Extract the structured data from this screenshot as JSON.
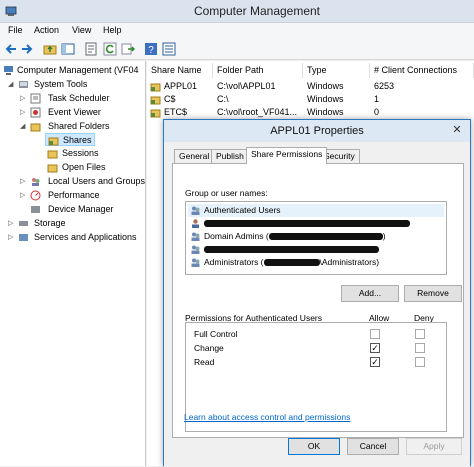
{
  "window": {
    "title": "Computer Management"
  },
  "menu": [
    "File",
    "Action",
    "View",
    "Help"
  ],
  "toolbar_icons": [
    "back-arrow-icon",
    "forward-arrow-icon",
    "up-folder-icon",
    "show-hide-tree-icon",
    "properties-icon",
    "refresh-icon",
    "export-list-icon",
    "help-icon",
    "view-icon"
  ],
  "tree": [
    {
      "label": "Computer Management (VF04",
      "caret": "",
      "level": 0,
      "icon": "computer-management-icon"
    },
    {
      "label": "System Tools",
      "caret": "◢",
      "level": 1,
      "icon": "system-tools-icon"
    },
    {
      "label": "Task Scheduler",
      "caret": "▷",
      "level": 2,
      "icon": "task-scheduler-icon"
    },
    {
      "label": "Event Viewer",
      "caret": "▷",
      "level": 2,
      "icon": "event-viewer-icon"
    },
    {
      "label": "Shared Folders",
      "caret": "◢",
      "level": 2,
      "icon": "shared-folders-icon"
    },
    {
      "label": "Shares",
      "caret": "",
      "level": 3,
      "icon": "shares-icon",
      "selected": true
    },
    {
      "label": "Sessions",
      "caret": "",
      "level": 3,
      "icon": "sessions-icon"
    },
    {
      "label": "Open Files",
      "caret": "",
      "level": 3,
      "icon": "open-files-icon"
    },
    {
      "label": "Local Users and Groups",
      "caret": "▷",
      "level": 2,
      "icon": "local-users-icon"
    },
    {
      "label": "Performance",
      "caret": "▷",
      "level": 2,
      "icon": "performance-icon"
    },
    {
      "label": "Device Manager",
      "caret": "",
      "level": 2,
      "icon": "device-manager-icon"
    },
    {
      "label": "Storage",
      "caret": "▷",
      "level": 1,
      "icon": "storage-icon"
    },
    {
      "label": "Services and Applications",
      "caret": "▷",
      "level": 1,
      "icon": "services-icon"
    }
  ],
  "shares_table": {
    "columns": [
      "Share Name",
      "Folder Path",
      "Type",
      "# Client Connections"
    ],
    "rows": [
      {
        "name": "APPL01",
        "path": "C:\\vol\\APPL01",
        "type": "Windows",
        "connections": "6253"
      },
      {
        "name": "C$",
        "path": "C:\\",
        "type": "Windows",
        "connections": "1"
      },
      {
        "name": "ETC$",
        "path": "C:\\vol\\root_VF041...",
        "type": "Windows",
        "connections": "0"
      }
    ]
  },
  "dialog": {
    "title": "APPL01 Properties",
    "tabs": [
      "General",
      "Publish",
      "Share Permissions",
      "Security"
    ],
    "active_tab": "Share Permissions",
    "group_label": "Group or user names:",
    "users": [
      {
        "name": "Authenticated Users",
        "icon": "group-users-icon",
        "redacted": false
      },
      {
        "name": "",
        "icon": "user-icon",
        "redacted": true
      },
      {
        "name": "Domain Admins (",
        "suffix": ")",
        "icon": "group-users-icon",
        "redacted": true
      },
      {
        "name": "",
        "icon": "group-users-icon",
        "redacted": true
      },
      {
        "name": "Administrators (",
        "suffix": "\\Administrators)",
        "icon": "group-users-icon",
        "redacted": true
      }
    ],
    "add_label": "Add...",
    "remove_label": "Remove",
    "permissions_label": "Permissions for Authenticated Users",
    "allow_label": "Allow",
    "deny_label": "Deny",
    "permissions": [
      {
        "name": "Full Control",
        "allow": false,
        "deny": false
      },
      {
        "name": "Change",
        "allow": true,
        "deny": false
      },
      {
        "name": "Read",
        "allow": true,
        "deny": false
      }
    ],
    "link_text": "Learn about access control and permissions",
    "ok_label": "OK",
    "cancel_label": "Cancel",
    "apply_label": "Apply"
  }
}
